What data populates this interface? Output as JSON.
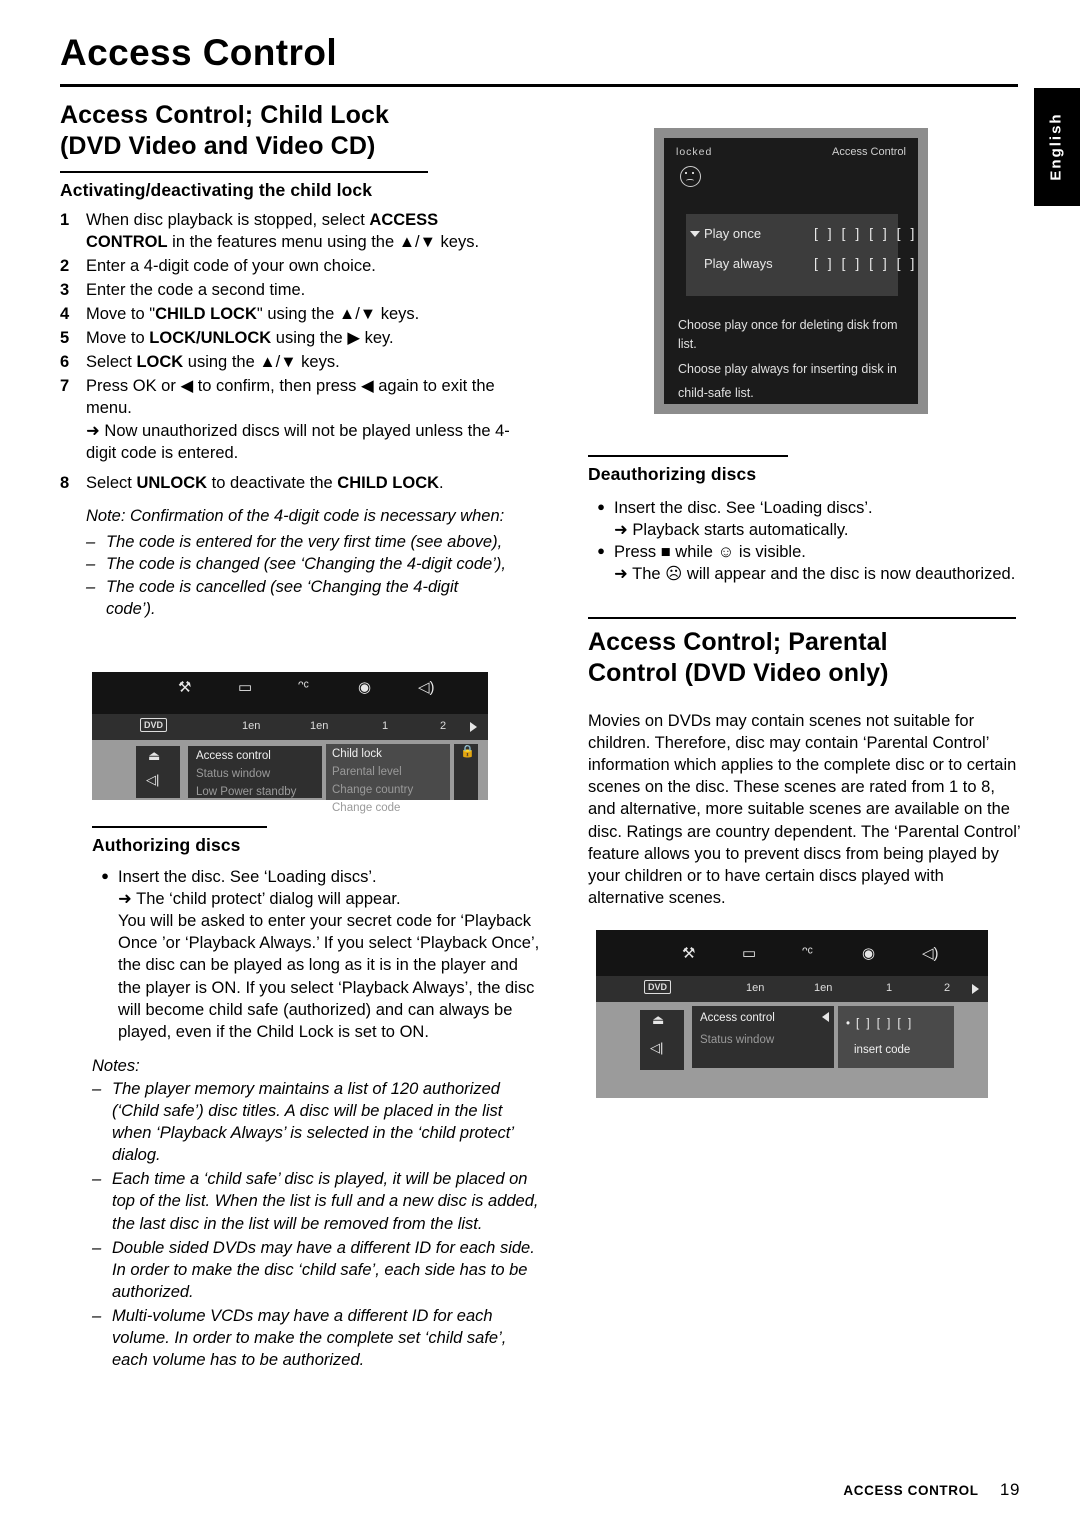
{
  "page": {
    "title": "Access Control",
    "side_tab": "English",
    "footer_label": "ACCESS CONTROL",
    "footer_page": "19"
  },
  "left": {
    "section1": {
      "heading_line1": "Access Control; Child Lock",
      "heading_line2": "(DVD Video and Video CD)",
      "subheading": "Activating/deactivating the child lock",
      "steps": [
        {
          "num": "1",
          "text": "When disc playback is stopped, select ACCESS CONTROL in the features menu using the ▲/▼ keys."
        },
        {
          "num": "2",
          "text": "Enter a 4-digit code of your own choice."
        },
        {
          "num": "3",
          "text": "Enter the code a second time."
        },
        {
          "num": "4",
          "text": "Move to \"CHILD LOCK\" using the ▲/▼ keys."
        },
        {
          "num": "5",
          "text": "Move to LOCK/UNLOCK using the ▶ key."
        },
        {
          "num": "6",
          "text": "Select LOCK using the ▲/▼ keys."
        },
        {
          "num": "7",
          "text": "Press OK or ◀ to confirm, then press ◀ again to exit the menu."
        },
        {
          "num": "8",
          "text": "Select UNLOCK to deactivate the CHILD LOCK."
        }
      ],
      "step7_arrow": "➜ Now unauthorized discs will not be played unless the 4-digit code is entered.",
      "note_intro": "Note: Confirmation of the 4-digit code is necessary when:",
      "note_items": [
        "The code is entered for the very first time (see above),",
        "The code is changed (see ‘Changing the 4-digit code’),",
        "The code is cancelled (see ‘Changing the 4-digit code’)."
      ]
    },
    "menu_shot_1": {
      "dvd_tag": "DVD",
      "bar_labels": [
        "1en",
        "1en",
        "1",
        "2"
      ],
      "column1": [
        "Access control",
        "Status window",
        "Low Power standby"
      ],
      "column2": [
        "Child lock",
        "Parental level",
        "Change country",
        "Change code"
      ]
    },
    "section2": {
      "subheading": "Authorizing discs",
      "bullet": "Insert the disc. See ‘Loading discs’.",
      "arrow": "➜ The ‘child protect’ dialog will appear.",
      "paragraph": "You will be asked to enter your secret code for ‘Playback Once ’or ‘Playback Always.’ If you select ‘Playback Once’, the disc can be played as long as it is in the player and the player is ON. If you select ‘Playback Always’, the disc will become child safe (authorized) and can always be played, even if the Child Lock is set to ON.",
      "notes_label": "Notes:",
      "notes": [
        "The player memory maintains a list of 120 authorized (‘Child safe’) disc titles. A disc will be placed in the list when ‘Playback Always’ is selected in the ‘child protect’ dialog.",
        "Each time a ‘child safe’ disc is played, it will be placed on top of the list. When the list is full and a new disc is added, the last disc in the list will be removed from the list.",
        "Double sided DVDs may have a different ID for each side. In order to make the disc ‘child safe’, each side has to be authorized.",
        "Multi-volume VCDs may have a different ID for each volume. In order to make the complete set ‘child safe’, each volume has to be authorized."
      ]
    }
  },
  "right": {
    "osd": {
      "status_left": "locked",
      "status_right": "Access Control",
      "option1": "Play once",
      "option2": "Play always",
      "code_boxes": "[ ] [ ] [ ] [ ]",
      "caption1": "Choose play once for deleting  disk from list.",
      "caption2": "Choose play always for inserting disk in",
      "caption3": "child-safe list."
    },
    "section_deauth": {
      "subheading": "Deauthorizing discs",
      "bullet1": "Insert the disc. See ‘Loading discs’.",
      "arrow1": "➜ Playback starts automatically.",
      "bullet2": "Press ■ while ☺ is visible.",
      "arrow2": "➜ The ☹ will appear and the disc is now deauthorized."
    },
    "section_parental": {
      "heading_line1": "Access Control; Parental",
      "heading_line2": "Control (DVD Video only)",
      "paragraph": "Movies on DVDs may contain scenes not suitable for children. Therefore, disc may contain ‘Parental Control’ information which applies to the complete disc or to certain scenes on the disc. These scenes are rated from 1 to 8, and alternative, more suitable scenes are available on the disc. Ratings are country dependent. The ‘Parental Control’ feature allows you to prevent discs from being played by your children or to have certain discs played with alternative scenes."
    },
    "menu_shot_2": {
      "dvd_tag": "DVD",
      "bar_labels": [
        "1en",
        "1en",
        "1",
        "2"
      ],
      "column1": [
        "Access control",
        "Status window"
      ],
      "code_boxes": "[ ] [ ] [ ]",
      "insert_code": "insert code"
    }
  }
}
